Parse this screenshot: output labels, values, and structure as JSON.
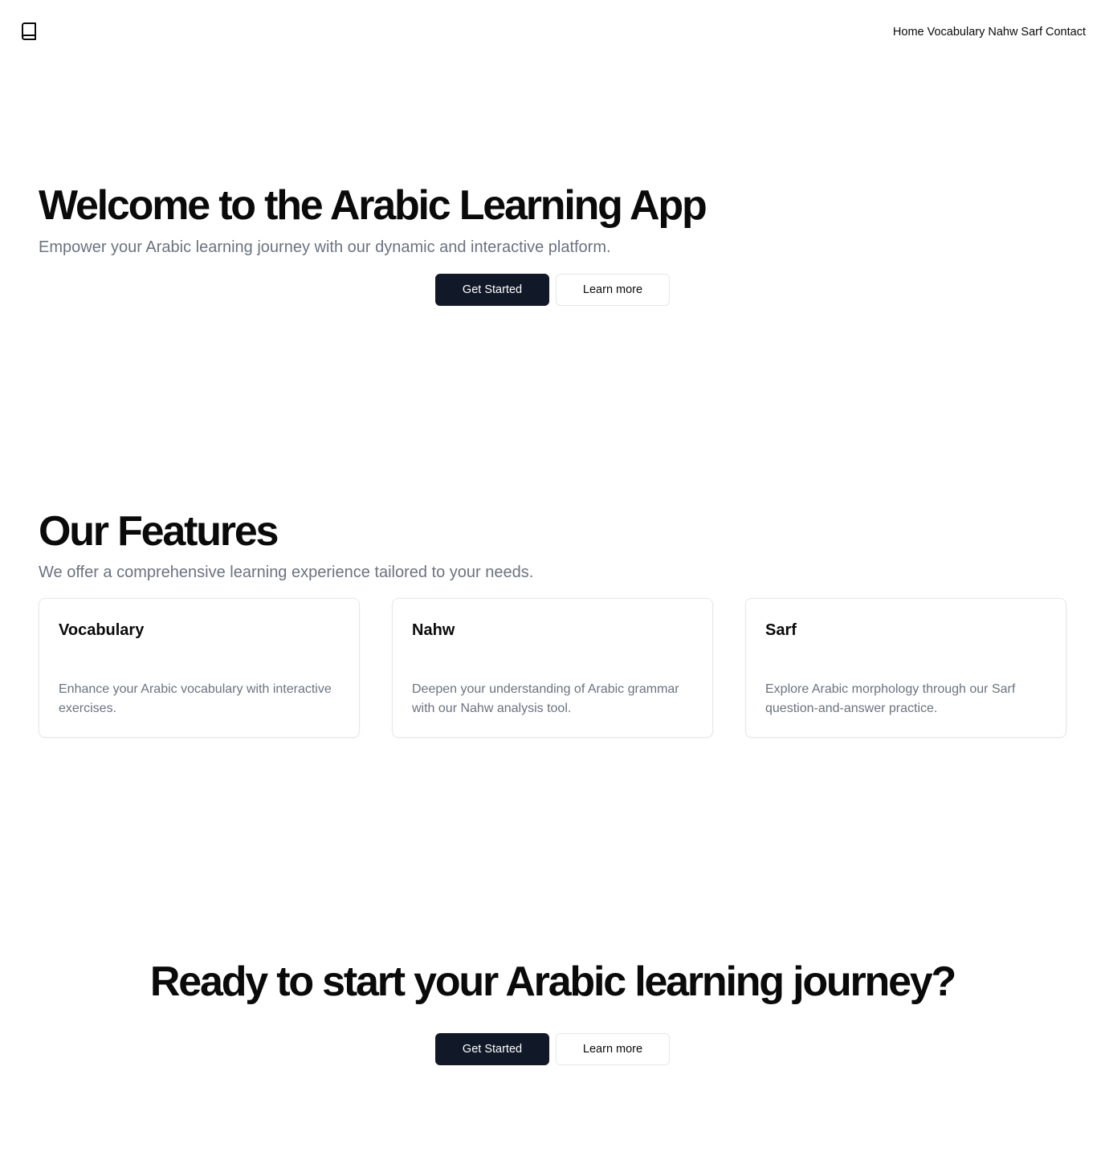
{
  "header": {
    "logo_icon": "book-icon",
    "nav": [
      "Home",
      "Vocabulary",
      "Nahw",
      "Sarf",
      "Contact"
    ]
  },
  "hero": {
    "title": "Welcome to the Arabic Learning App",
    "subtitle": "Empower your Arabic learning journey with our dynamic and interactive platform.",
    "primary_label": "Get Started",
    "secondary_label": "Learn more"
  },
  "features": {
    "title": "Our Features",
    "subtitle": "We offer a comprehensive learning experience tailored to your needs.",
    "cards": [
      {
        "title": "Vocabulary",
        "description": "Enhance your Arabic vocabulary with interactive exercises."
      },
      {
        "title": "Nahw",
        "description": "Deepen your understanding of Arabic grammar with our Nahw analysis tool."
      },
      {
        "title": "Sarf",
        "description": "Explore Arabic morphology through our Sarf question-and-answer practice."
      }
    ]
  },
  "cta": {
    "title": "Ready to start your Arabic learning journey?",
    "primary_label": "Get Started",
    "secondary_label": "Learn more"
  },
  "colors": {
    "primary": "#111827",
    "muted_text": "#6b7280",
    "border": "#e5e7eb"
  }
}
